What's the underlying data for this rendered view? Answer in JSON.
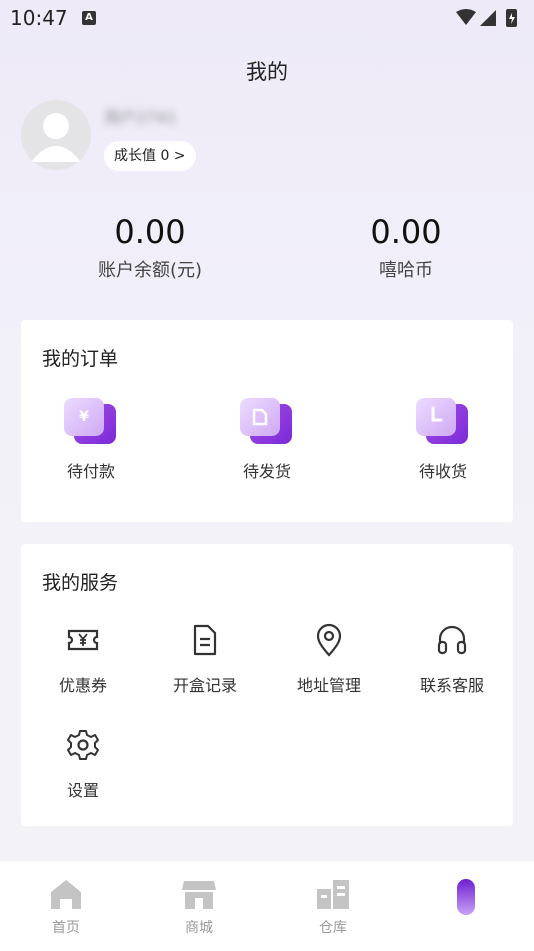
{
  "status_bar": {
    "time": "10:47",
    "notif_icon": "A"
  },
  "header": {
    "title": "我的"
  },
  "profile": {
    "username": "用户2741",
    "growth_label": "成长值 0 >"
  },
  "stats": [
    {
      "value": "0.00",
      "label": "账户余额(元)"
    },
    {
      "value": "0.00",
      "label": "嘻哈币"
    }
  ],
  "orders": {
    "title": "我的订单",
    "items": [
      {
        "label": "待付款",
        "icon": "payment-icon",
        "glyph": "¥"
      },
      {
        "label": "待发货",
        "icon": "shipping-icon",
        "glyph": ""
      },
      {
        "label": "待收货",
        "icon": "receive-icon",
        "glyph": ""
      }
    ]
  },
  "services": {
    "title": "我的服务",
    "items": [
      {
        "label": "优惠券",
        "icon": "coupon-icon"
      },
      {
        "label": "开盒记录",
        "icon": "document-icon"
      },
      {
        "label": "地址管理",
        "icon": "location-icon"
      },
      {
        "label": "联系客服",
        "icon": "headset-icon"
      },
      {
        "label": "设置",
        "icon": "gear-icon"
      }
    ]
  },
  "tabbar": {
    "items": [
      {
        "label": "首页",
        "icon": "home-icon"
      },
      {
        "label": "商城",
        "icon": "store-icon"
      },
      {
        "label": "仓库",
        "icon": "warehouse-icon"
      },
      {
        "label": "",
        "icon": "profile-tab-icon"
      }
    ]
  },
  "colors": {
    "accent": "#8a36e0",
    "inactive": "#c4c4c4"
  }
}
